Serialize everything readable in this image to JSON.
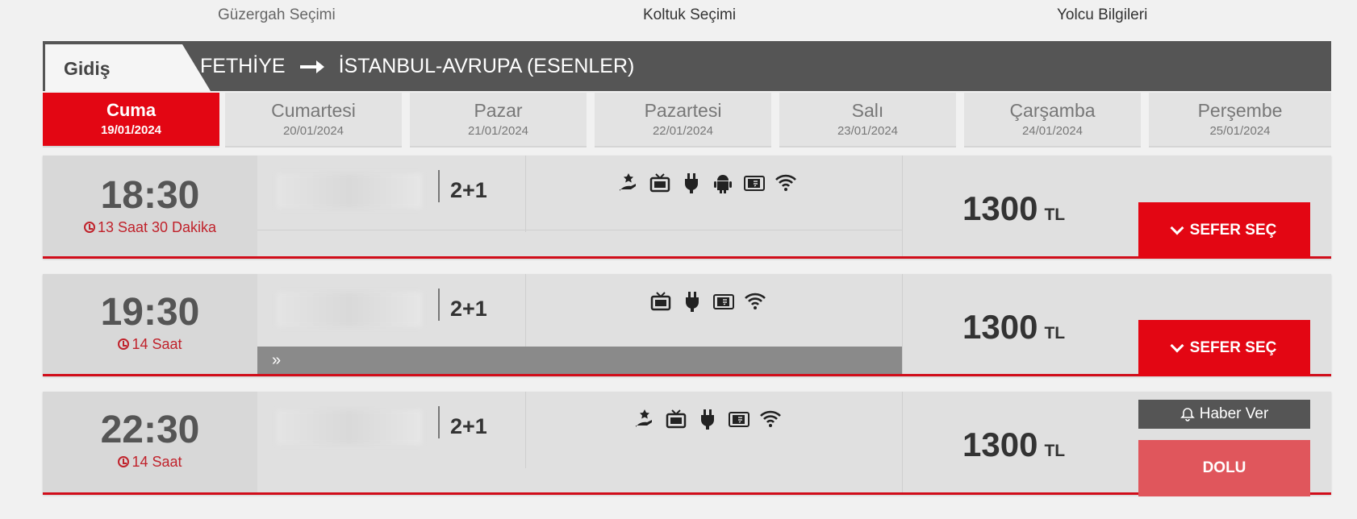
{
  "steps": [
    "Güzergah Seçimi",
    "Koltuk Seçimi",
    "Yolcu Bilgileri"
  ],
  "route": {
    "direction_label": "Gidiş",
    "from": "FETHİYE",
    "to": "İSTANBUL-AVRUPA (ESENLER)"
  },
  "days": [
    {
      "name": "Cuma",
      "date": "19/01/2024",
      "active": true
    },
    {
      "name": "Cumartesi",
      "date": "20/01/2024"
    },
    {
      "name": "Pazar",
      "date": "21/01/2024"
    },
    {
      "name": "Pazartesi",
      "date": "22/01/2024"
    },
    {
      "name": "Salı",
      "date": "23/01/2024"
    },
    {
      "name": "Çarşamba",
      "date": "24/01/2024"
    },
    {
      "name": "Perşembe",
      "date": "25/01/2024"
    }
  ],
  "trips": [
    {
      "time": "18:30",
      "duration": "13 Saat 30 Dakika",
      "seat_layout": "2+1",
      "amenities": [
        "service-icon",
        "tv-icon",
        "power-plug-icon",
        "android-icon",
        "tablet-icon",
        "wifi-icon"
      ],
      "price": "1300",
      "currency": "TL",
      "action": "SEFER SEÇ"
    },
    {
      "time": "19:30",
      "duration": "14 Saat",
      "seat_layout": "2+1",
      "amenities": [
        "tv-icon",
        "power-plug-icon",
        "tablet-icon",
        "wifi-icon"
      ],
      "price": "1300",
      "currency": "TL",
      "action": "SEFER SEÇ",
      "expand_label": "»"
    },
    {
      "time": "22:30",
      "duration": "14 Saat",
      "seat_layout": "2+1",
      "amenities": [
        "service-icon",
        "tv-icon",
        "power-plug-icon",
        "tablet-icon",
        "wifi-icon"
      ],
      "price": "1300",
      "currency": "TL",
      "notify": "Haber Ver",
      "status": "DOLU"
    }
  ],
  "colors": {
    "accent": "#e30613",
    "dark_bar": "#555555",
    "full": "#e0565c"
  }
}
